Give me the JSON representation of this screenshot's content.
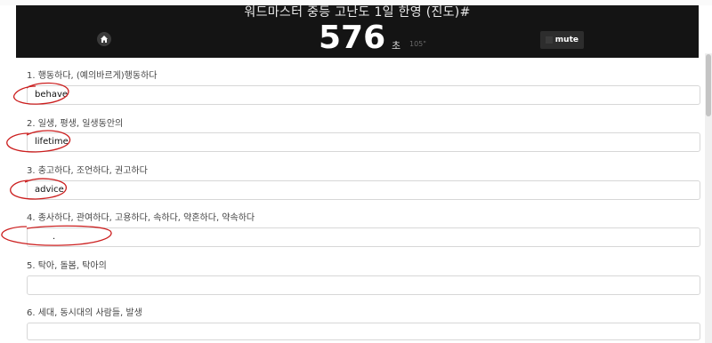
{
  "header": {
    "title": "워드마스터 중등 고난도 1일 한영 (진도)#",
    "timer": "576",
    "timer_unit": "초",
    "timer_total": "105\"",
    "mute_label": "mute"
  },
  "questions": [
    {
      "prompt": "1. 행동하다, (예의바르게)행동하다",
      "answer": "behave"
    },
    {
      "prompt": "2. 일생, 평생, 일생동안의",
      "answer": "lifetime"
    },
    {
      "prompt": "3. 충고하다, 조언하다, 권고하다",
      "answer": "advice"
    },
    {
      "prompt": "4. 종사하다, 관여하다, 고용하다, 속하다, 약혼하다, 약속하다",
      "answer": "."
    },
    {
      "prompt": "5. 탁아, 돌봄, 탁아의",
      "answer": ""
    },
    {
      "prompt": "6. 세대, 동시대의 사람들, 발생",
      "answer": ""
    }
  ],
  "colors": {
    "header_bg": "#141414",
    "annotation": "#cc1f1f"
  },
  "icons": {
    "home": "home-icon",
    "speaker": "speaker-icon"
  }
}
